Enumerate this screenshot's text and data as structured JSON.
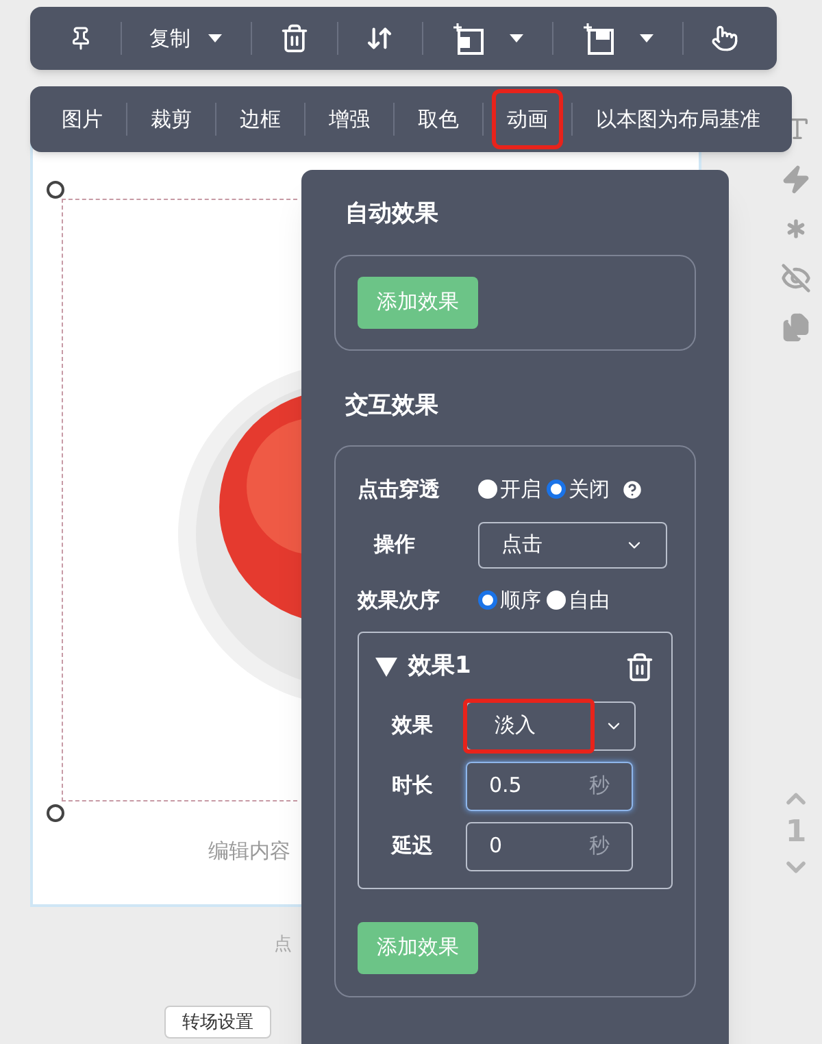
{
  "toolbar": {
    "copy_label": "复制"
  },
  "image_menu": {
    "items": [
      {
        "label": "图片",
        "selected": false
      },
      {
        "label": "裁剪",
        "selected": false
      },
      {
        "label": "边框",
        "selected": false
      },
      {
        "label": "增强",
        "selected": false
      },
      {
        "label": "取色",
        "selected": false
      },
      {
        "label": "动画",
        "selected": true
      },
      {
        "label": "以本图为布局基准",
        "selected": false
      }
    ]
  },
  "canvas": {
    "caption": "编辑内容",
    "hint": "点",
    "transition_button": "转场设置"
  },
  "page_nav": {
    "page": "1"
  },
  "animation_panel": {
    "auto_title": "自动效果",
    "auto_add_button": "添加效果",
    "interactive_title": "交互效果",
    "click_through": {
      "label": "点击穿透",
      "options": [
        {
          "label": "开启",
          "selected": false
        },
        {
          "label": "关闭",
          "selected": true
        }
      ]
    },
    "action": {
      "label": "操作",
      "value": "点击"
    },
    "order": {
      "label": "效果次序",
      "options": [
        {
          "label": "顺序",
          "selected": true
        },
        {
          "label": "自由",
          "selected": false
        }
      ]
    },
    "effects": [
      {
        "title": "效果1",
        "expanded": true,
        "effect_label": "效果",
        "effect_value": "淡入",
        "highlighted": true,
        "duration_label": "时长",
        "duration_value": "0.5",
        "duration_unit": "秒",
        "duration_focused": true,
        "delay_label": "延迟",
        "delay_value": "0",
        "delay_unit": "秒"
      }
    ],
    "add_button": "添加效果"
  }
}
